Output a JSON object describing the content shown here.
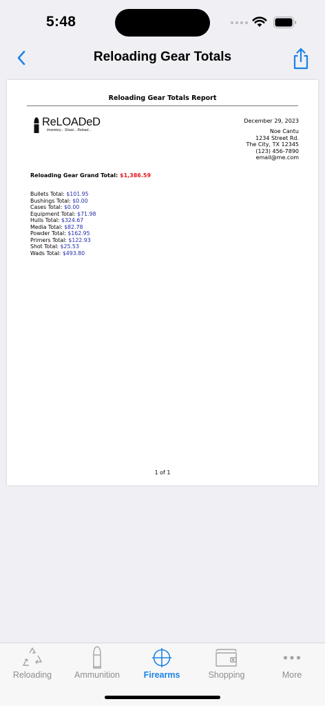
{
  "status_bar": {
    "time": "5:48"
  },
  "nav": {
    "title": "Reloading Gear Totals"
  },
  "report": {
    "title": "Reloading Gear Totals Report",
    "logo_name": "ReLOADeD",
    "logo_tagline": "Inventory... Shoot... Reload...",
    "date": "December 29, 2023",
    "address": [
      "Noe Cantu",
      "1234 Street Rd.",
      "The City, TX 12345",
      "(123) 456-7890",
      "email@me.com"
    ],
    "grand_total_label": "Reloading Gear Grand Total:",
    "grand_total_value": "$1,386.59",
    "totals": [
      {
        "label": "Bullets Total:",
        "value": "$101.95"
      },
      {
        "label": "Bushings Total:",
        "value": "$0.00"
      },
      {
        "label": "Cases Total:",
        "value": "$0.00"
      },
      {
        "label": "Equipment Total:",
        "value": "$71.98"
      },
      {
        "label": "Hulls Total:",
        "value": "$324.67"
      },
      {
        "label": "Media Total:",
        "value": "$82.78"
      },
      {
        "label": "Powder Total:",
        "value": "$162.95"
      },
      {
        "label": "Primers Total:",
        "value": "$122.93"
      },
      {
        "label": "Shot Total:",
        "value": "$25.53"
      },
      {
        "label": "Wads Total:",
        "value": "$493.80"
      }
    ],
    "page_indicator": "1 of 1"
  },
  "tab_bar": {
    "active": "Firearms",
    "tabs": [
      {
        "label": "Reloading",
        "icon": "recycle-icon"
      },
      {
        "label": "Ammunition",
        "icon": "cartridge-icon"
      },
      {
        "label": "Firearms",
        "icon": "crosshair-icon"
      },
      {
        "label": "Shopping",
        "icon": "wallet-icon"
      },
      {
        "label": "More",
        "icon": "ellipsis-icon"
      }
    ]
  },
  "colors": {
    "accent": "#1b82e6",
    "grand_total": "#e0171f",
    "line_value": "#1f2aa8",
    "inactive": "#8e8e93"
  }
}
